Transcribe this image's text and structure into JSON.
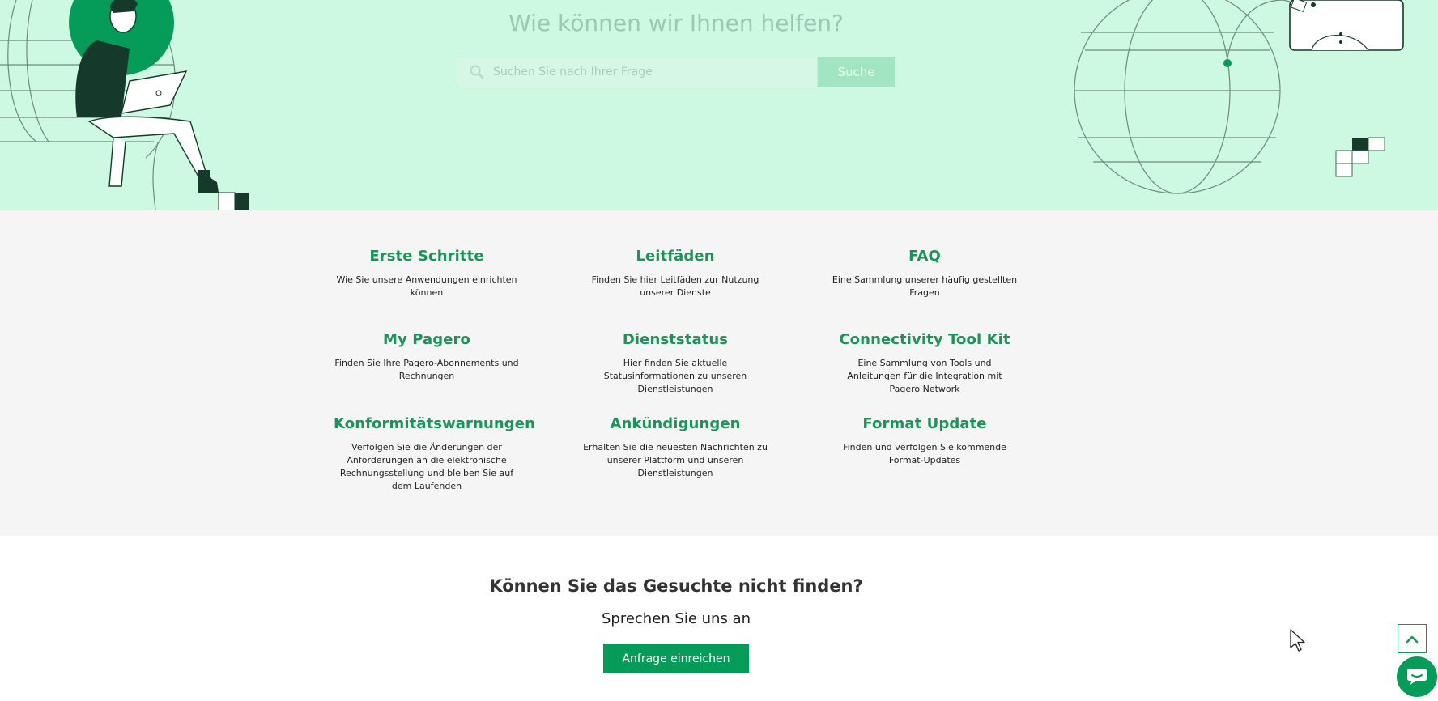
{
  "hero": {
    "title": "Wie können wir Ihnen helfen?",
    "search_placeholder": "Suchen Sie nach Ihrer Frage",
    "search_button": "Suche"
  },
  "categories": [
    {
      "title": "Erste Schritte",
      "desc": "Wie Sie unsere Anwendungen einrichten können"
    },
    {
      "title": "Leitfäden",
      "desc": "Finden Sie hier Leitfäden zur Nutzung unserer Dienste"
    },
    {
      "title": "FAQ",
      "desc": "Eine Sammlung unserer häufig gestellten Fragen"
    },
    {
      "title": "My Pagero",
      "desc": "Finden Sie Ihre Pagero-Abonnements und Rechnungen"
    },
    {
      "title": "Dienststatus",
      "desc": "Hier finden Sie aktuelle Statusinformationen zu unseren Dienstleistungen"
    },
    {
      "title": "Connectivity Tool Kit",
      "desc": "Eine Sammlung von Tools und Anleitungen für die Integration mit Pagero Network"
    },
    {
      "title": "Konformitätswarnungen",
      "desc": "Verfolgen Sie die Änderungen der Anforderungen an die elektronische Rechnungsstellung und bleiben Sie auf dem Laufenden"
    },
    {
      "title": "Ankündigungen",
      "desc": "Erhalten Sie die neuesten Nachrichten zu unserer Plattform und unseren Dienstleistungen"
    },
    {
      "title": "Format Update",
      "desc": "Finden und verfolgen Sie kommende Format-Updates"
    }
  ],
  "contact": {
    "title": "Können Sie das Gesuchte nicht finden?",
    "subtitle": "Sprechen Sie uns an",
    "button": "Anfrage einreichen"
  },
  "colors": {
    "brand_green": "#059b59",
    "heading_green": "#1c9358",
    "hero_bg": "#cdf8e2",
    "section_bg": "#f5f5f5"
  },
  "icons": {
    "search": "search-icon",
    "scroll_top": "chevron-up-icon",
    "chat": "chat-bubble-icon",
    "cursor": "mouse-cursor-icon"
  }
}
